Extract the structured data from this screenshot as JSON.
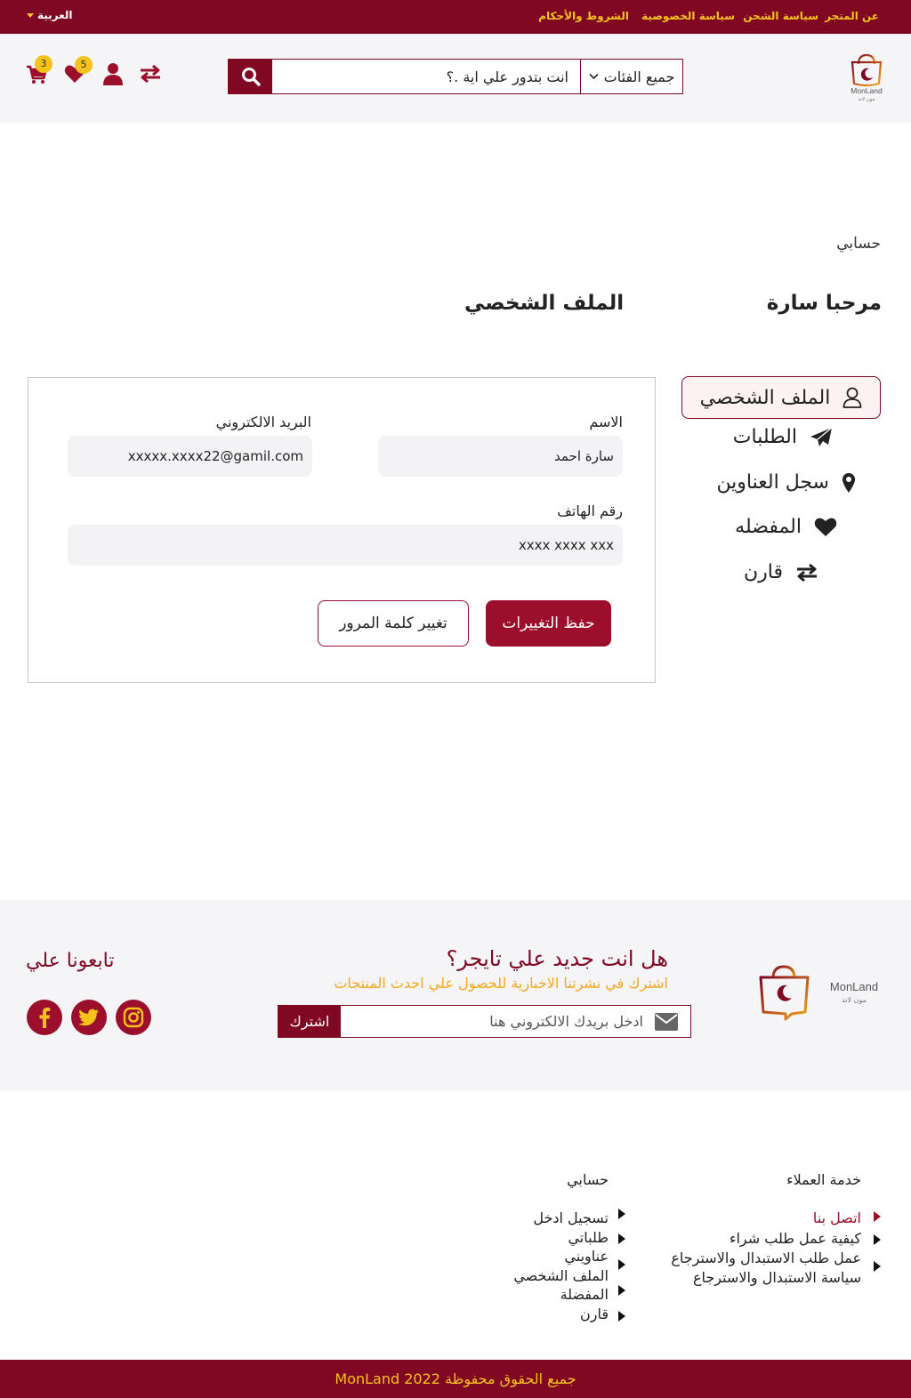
{
  "colors": {
    "brand": "#800823",
    "accent": "#f5c21b",
    "button": "#9b0f2c"
  },
  "topbar": {
    "links": [
      "عن المتجر",
      "سياسة الشحن",
      "سياسة الخصوصية",
      "الشروط والأحكام"
    ],
    "language": "العربية"
  },
  "header": {
    "logo_text": "MonLand",
    "logo_subtext": "مون لاند",
    "category_select": "جميع الفئات",
    "search_placeholder": "انت بتدور علي اية .؟",
    "wishlist_count": "5",
    "cart_count": "3",
    "icons": [
      "compare-icon",
      "user-icon",
      "heart-icon",
      "cart-icon",
      "search-icon"
    ]
  },
  "breadcrumb": "حسابي",
  "welcome": "مرحبا  سارة",
  "page_title": "الملف الشخصي",
  "menu": {
    "items": [
      {
        "label": "الملف الشخصي",
        "icon": "user-icon"
      },
      {
        "label": "الطلبات",
        "icon": "send-icon"
      },
      {
        "label": "سجل العناوين",
        "icon": "location-pin-icon"
      },
      {
        "label": "المفضله",
        "icon": "heart-icon"
      },
      {
        "label": "قارن",
        "icon": "compare-icon"
      }
    ]
  },
  "form": {
    "name_label": "الاسم",
    "name_value": "سارة احمد",
    "email_label": "البريد الالكتروني",
    "email_value": "xxxxx.xxxx22@gamil.com",
    "phone_label": "رقم الهاتف",
    "phone_value": "xxxx xxxx xxx",
    "save_label": "حفظ التغييرات",
    "change_password_label": "تغيير كلمة المرور"
  },
  "newsletter": {
    "title": "هل انت جديد علي تايجر؟",
    "subtitle": "اشترك في نشرتنا الاخبارية للحصول علي احدث المنتجات",
    "placeholder": "ادخل بريدك الالكتروني هنا",
    "button": "اشترك",
    "follow_label": "تابعونا علي",
    "social": [
      "instagram-icon",
      "twitter-icon",
      "facebook-icon"
    ]
  },
  "footer": {
    "customer_service": {
      "title": "خدمة العملاء",
      "links": [
        "اتصل بنا",
        "كيفية عمل طلب شراء",
        "عمل طلب الاستبدال والاسترجاع",
        "سياسة الاستبدال والاسترجاع"
      ]
    },
    "account": {
      "title": "حسابي",
      "links": [
        "تسجيل  ادخل",
        "طلباتي",
        "عناويني",
        "الملف الشخصي",
        "المفضلة",
        "قارن"
      ]
    },
    "copyright": "جميع الحقوق محفوظة  MonLand 2022"
  }
}
